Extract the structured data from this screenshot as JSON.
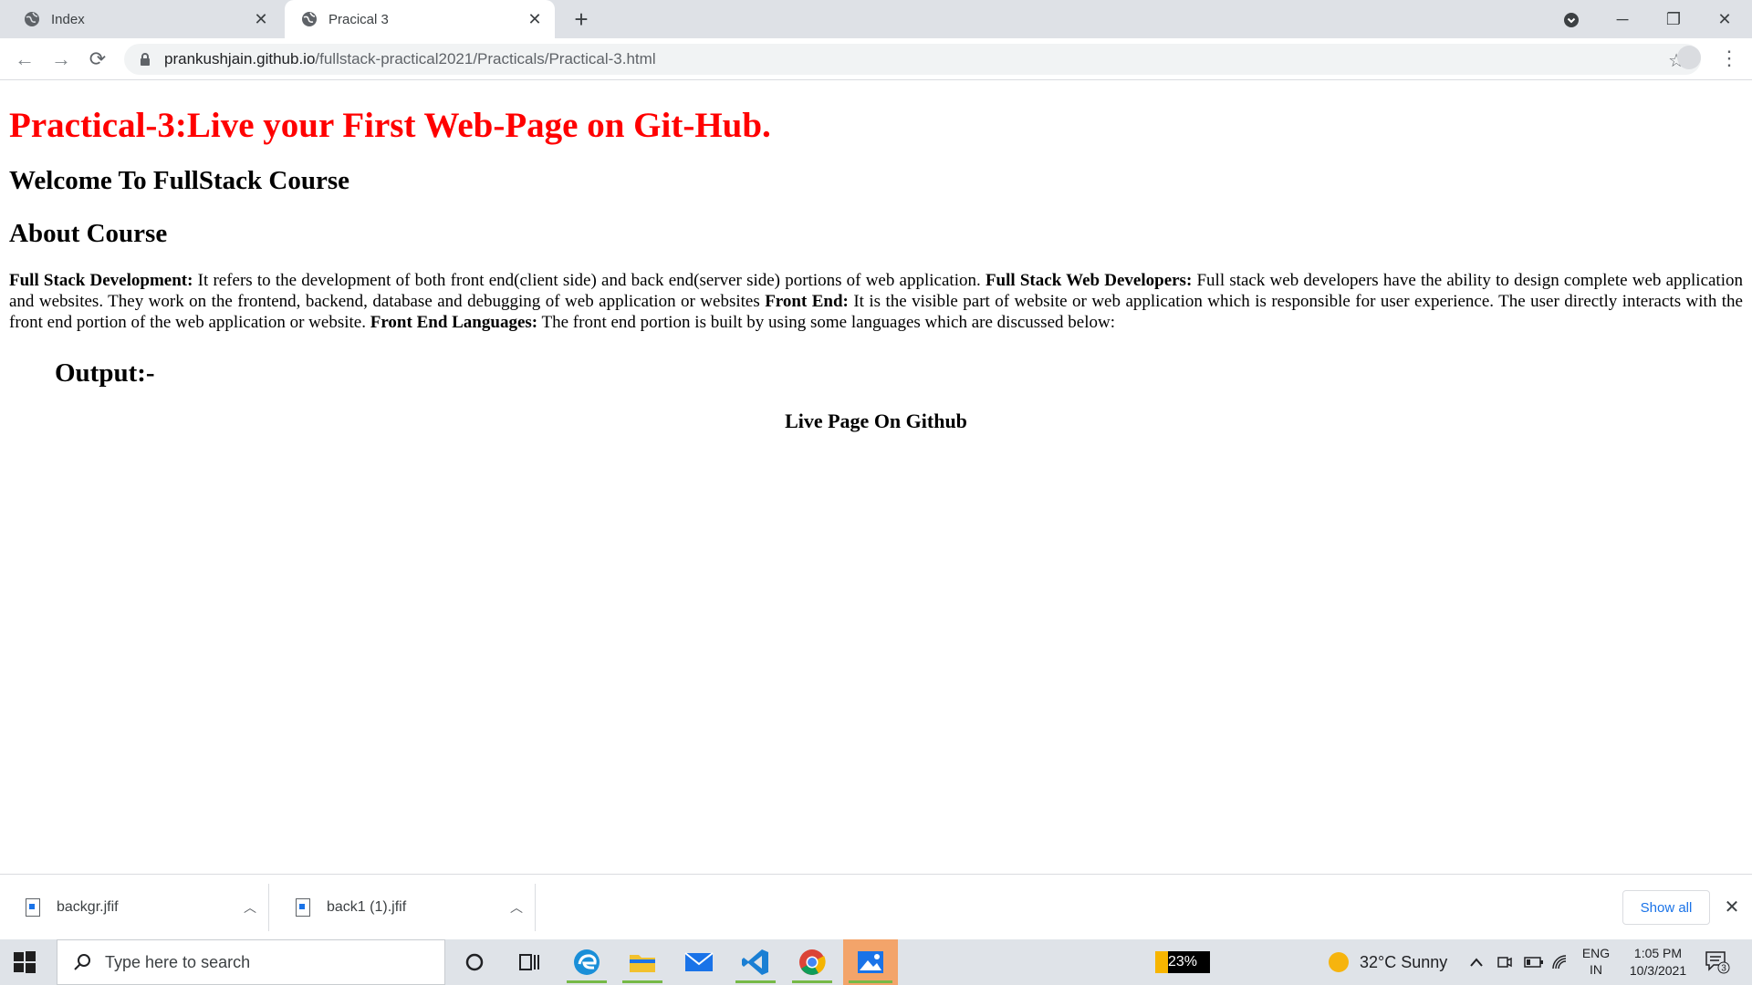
{
  "browser": {
    "tabs": [
      {
        "title": "Index",
        "active": false
      },
      {
        "title": "Pracical 3",
        "active": true
      }
    ],
    "new_tab_label": "+",
    "url_host": "prankushjain.github.io",
    "url_path": "/fullstack-practical2021/Practicals/Practical-3.html"
  },
  "page": {
    "title": "Practical-3:Live your First Web-Page on Git-Hub.",
    "welcome": "Welcome To FullStack Course",
    "about_heading": "About Course",
    "paragraph": [
      {
        "bold": "Full Stack Development:",
        "text": " It refers to the development of both front end(client side) and back end(server side) portions of web application. "
      },
      {
        "bold": "Full Stack Web Developers:",
        "text": " Full stack web developers have the ability to design complete web application and websites. They work on the frontend, backend, database and debugging of web application or websites "
      },
      {
        "bold": "Front End:",
        "text": " It is the visible part of website or web application which is responsible for user experience. The user directly interacts with the front end portion of the web application or website. "
      },
      {
        "bold": "Front End Languages:",
        "text": " The front end portion is built by using some languages which are discussed below:"
      }
    ],
    "output_heading": "Output:-",
    "live_heading": "Live Page On Github"
  },
  "downloads": {
    "items": [
      {
        "name": "backgr.jfif"
      },
      {
        "name": "back1 (1).jfif"
      }
    ],
    "show_all": "Show all"
  },
  "taskbar": {
    "search_placeholder": "Type here to search",
    "battery": "23%",
    "weather": "32°C  Sunny",
    "lang_top": "ENG",
    "lang_bottom": "IN",
    "time": "1:05 PM",
    "date": "10/3/2021",
    "notification_count": "3"
  }
}
